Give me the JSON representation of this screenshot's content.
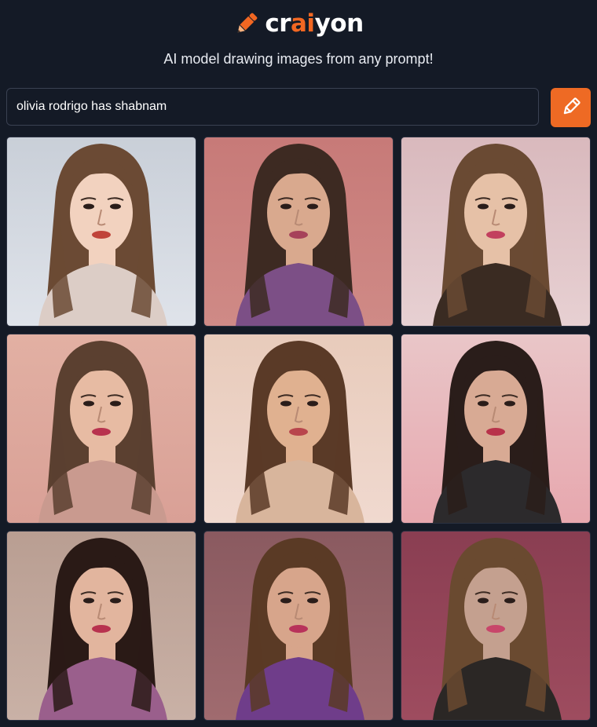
{
  "app": {
    "logo_prefix": "cr",
    "logo_accent": "ai",
    "logo_suffix": "yon",
    "tagline": "AI model drawing images from any prompt!",
    "accent_color": "#f26722",
    "background_color": "#141a26"
  },
  "search": {
    "value": "olivia rodrigo has shabnam",
    "draw_button_icon": "pencil-icon"
  },
  "results": [
    {
      "name": "result-image-1",
      "bg": "#dfe3ea",
      "top": "#c9cfd8",
      "hair": "#6b4a34",
      "skin": "#f2d2bf",
      "outfit": "#dccdc6",
      "lips": "#c0443a"
    },
    {
      "name": "result-image-2",
      "bg": "#cf8a86",
      "top": "#c77a78",
      "hair": "#3d2a22",
      "skin": "#d9a98e",
      "outfit": "#7c4f86",
      "lips": "#a6425a"
    },
    {
      "name": "result-image-3",
      "bg": "#e7d0d2",
      "top": "#d9b9bd",
      "hair": "#6a4a33",
      "skin": "#e6c1a7",
      "outfit": "#3a2b22",
      "lips": "#c2405e"
    },
    {
      "name": "result-image-4",
      "bg": "#d9a096",
      "top": "#e2b0a3",
      "hair": "#5b4030",
      "skin": "#e7bba3",
      "outfit": "#c99a8f",
      "lips": "#b8324e"
    },
    {
      "name": "result-image-5",
      "bg": "#f0d9cf",
      "top": "#e8cbbb",
      "hair": "#5a3a27",
      "skin": "#e0b190",
      "outfit": "#d8b59c",
      "lips": "#b8454c"
    },
    {
      "name": "result-image-6",
      "bg": "#e7a7ae",
      "top": "#e9c6c8",
      "hair": "#2a1d1a",
      "skin": "#d8aa94",
      "outfit": "#2c2a2c",
      "lips": "#b8324a"
    },
    {
      "name": "result-image-7",
      "bg": "#c9b1a6",
      "top": "#b99e92",
      "hair": "#2a1a16",
      "skin": "#e2b59e",
      "outfit": "#9a5f8c",
      "lips": "#b8324e"
    },
    {
      "name": "result-image-8",
      "bg": "#a06b6f",
      "top": "#8a5a60",
      "hair": "#5a3a25",
      "skin": "#d7a58b",
      "outfit": "#6f3d8a",
      "lips": "#b8325a"
    },
    {
      "name": "result-image-9",
      "bg": "#9e4c5f",
      "top": "#8a3e52",
      "hair": "#6a4a30",
      "skin": "#c4a08f",
      "outfit": "#2b2725",
      "lips": "#c8466a"
    }
  ]
}
